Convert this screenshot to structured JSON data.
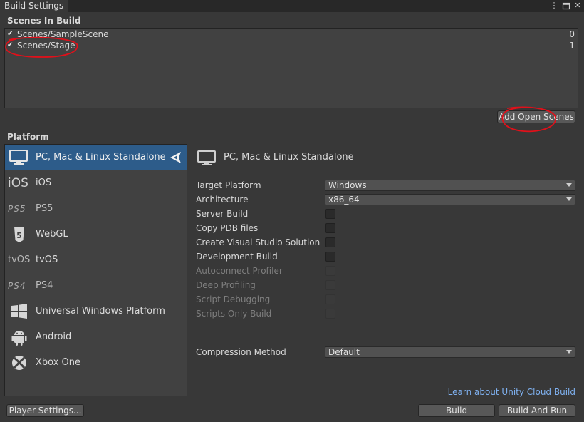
{
  "window": {
    "title": "Build Settings"
  },
  "scenes": {
    "header": "Scenes In Build",
    "items": [
      {
        "name": "Scenes/SampleScene",
        "index": "0",
        "checked": true
      },
      {
        "name": "Scenes/Stage",
        "index": "1",
        "checked": true
      }
    ],
    "add_open_scenes_label": "Add Open Scenes"
  },
  "platform": {
    "header": "Platform",
    "items": [
      {
        "label": "PC, Mac & Linux Standalone",
        "icon": "monitor-icon",
        "selected": true
      },
      {
        "label": "iOS",
        "icon": "ios-icon",
        "icon_text": "iOS"
      },
      {
        "label": "PS5",
        "icon": "ps5-icon",
        "icon_text": "PS5"
      },
      {
        "label": "WebGL",
        "icon": "html5-icon",
        "icon_text": "5"
      },
      {
        "label": "tvOS",
        "icon": "tvos-icon",
        "icon_text": "tvOS"
      },
      {
        "label": "PS4",
        "icon": "ps4-icon",
        "icon_text": "PS4"
      },
      {
        "label": "Universal Windows Platform",
        "icon": "windows-icon"
      },
      {
        "label": "Android",
        "icon": "android-icon"
      },
      {
        "label": "Xbox One",
        "icon": "xbox-icon"
      }
    ]
  },
  "settings": {
    "title": "PC, Mac & Linux Standalone",
    "target_platform": {
      "label": "Target Platform",
      "value": "Windows"
    },
    "architecture": {
      "label": "Architecture",
      "value": "x86_64"
    },
    "options": [
      {
        "label": "Server Build",
        "enabled": true
      },
      {
        "label": "Copy PDB files",
        "enabled": true
      },
      {
        "label": "Create Visual Studio Solution",
        "enabled": true
      },
      {
        "label": "Development Build",
        "enabled": true
      },
      {
        "label": "Autoconnect Profiler",
        "enabled": false
      },
      {
        "label": "Deep Profiling",
        "enabled": false
      },
      {
        "label": "Script Debugging",
        "enabled": false
      },
      {
        "label": "Scripts Only Build",
        "enabled": false
      }
    ],
    "compression": {
      "label": "Compression Method",
      "value": "Default"
    }
  },
  "footer": {
    "cloud_link": "Learn about Unity Cloud Build",
    "player_settings": "Player Settings...",
    "build": "Build",
    "build_and_run": "Build And Run"
  },
  "colors": {
    "selection": "#2d5c8a",
    "annotation": "#e0101a",
    "link": "#7fb1f0"
  }
}
